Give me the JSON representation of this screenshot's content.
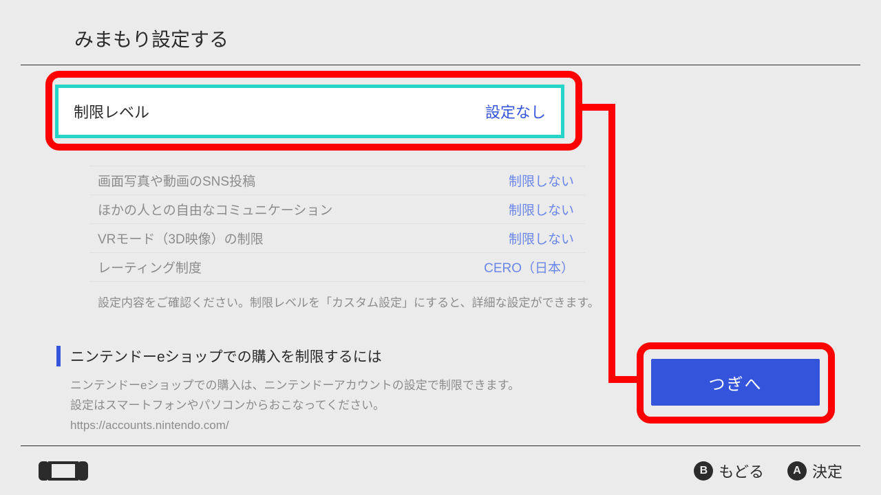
{
  "header": {
    "title": "みまもり設定する"
  },
  "restriction": {
    "label": "制限レベル",
    "value": "設定なし"
  },
  "sublist": [
    {
      "label": "画面写真や動画のSNS投稿",
      "value": "制限しない"
    },
    {
      "label": "ほかの人との自由なコミュニケーション",
      "value": "制限しない"
    },
    {
      "label": "VRモード（3D映像）の制限",
      "value": "制限しない"
    },
    {
      "label": "レーティング制度",
      "value": "CERO（日本）"
    }
  ],
  "note": "設定内容をご確認ください。制限レベルを「カスタム設定」にすると、詳細な設定ができます。",
  "eshop": {
    "title": "ニンテンドーeショップでの購入を制限するには",
    "line1": "ニンテンドーeショップでの購入は、ニンテンドーアカウントの設定で制限できます。",
    "line2": "設定はスマートフォンやパソコンからおこなってください。",
    "url": "https://accounts.nintendo.com/"
  },
  "next": "つぎへ",
  "footer": {
    "b_label": "もどる",
    "a_label": "決定",
    "b_glyph": "B",
    "a_glyph": "A"
  }
}
